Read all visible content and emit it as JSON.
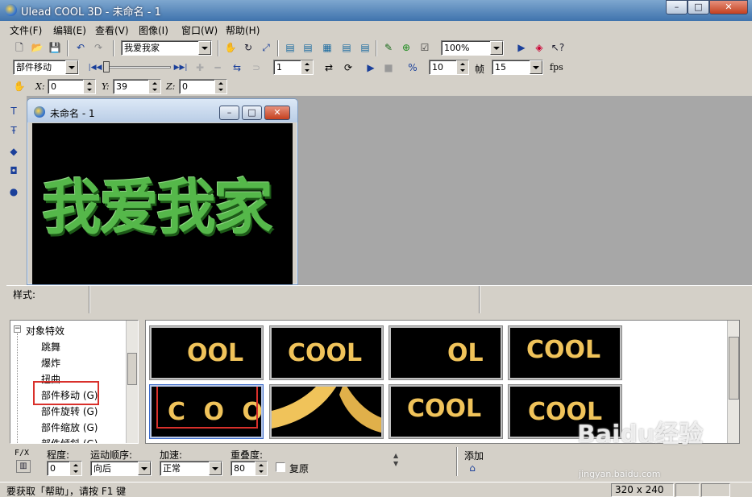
{
  "app": {
    "title": "Ulead COOL 3D - 未命名 - 1"
  },
  "menu": [
    "文件(F)",
    "编辑(E)",
    "查看(V)",
    "图像(I)",
    "窗口(W)",
    "帮助(H)"
  ],
  "toolbar1": {
    "text_select": "我爱我家",
    "zoom": "100%"
  },
  "toolbar2": {
    "mode": "部件移动",
    "frame_value": "1",
    "speed_value": "10",
    "frame_label": "帧",
    "fps_value": "15",
    "fps_label": "fps"
  },
  "toolbar3": {
    "x_label": "X:",
    "x_value": "0",
    "y_label": "Y:",
    "y_value": "39",
    "z_label": "Z:",
    "z_value": "0"
  },
  "document": {
    "title": "未命名 - 1",
    "text": "我爱我家"
  },
  "styles": {
    "label": "样式:"
  },
  "tree": {
    "root": "对象特效",
    "items": [
      "跳舞",
      "爆炸",
      "扭曲",
      "部件移动 (G)",
      "部件旋转 (G)",
      "部件缩放 (G)",
      "部件倾斜 (G)"
    ],
    "selected": 3
  },
  "gallery": {
    "row1": [
      "OOL",
      "COOL",
      "OL",
      "COOL"
    ],
    "row2_first": "C O O",
    "row2_third": "COOL",
    "row2_fourth": "COOL"
  },
  "params": {
    "fx_label": "F/X",
    "degree_label": "程度:",
    "degree_value": "0",
    "order_label": "运动顺序:",
    "order_value": "向后",
    "accel_label": "加速:",
    "accel_value": "正常",
    "overlap_label": "重叠度:",
    "overlap_value": "80",
    "restore_label": "复原",
    "add_label": "添加"
  },
  "status": {
    "hint": "要获取「帮助」，请按 F1 键",
    "size": "320 x 240"
  },
  "watermark": {
    "brand": "Baidu经验",
    "url": "jingyan.baidu.com"
  },
  "colors": {
    "title_bar": "#3f73ad",
    "selection_red": "#d9302b",
    "text_green": "#55b84a",
    "thumb_gold": "#f0c35a"
  }
}
